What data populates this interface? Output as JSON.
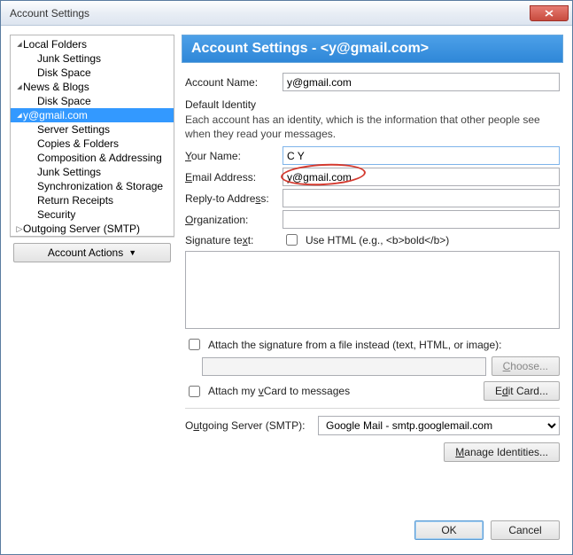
{
  "window": {
    "title": "Account Settings"
  },
  "tree": {
    "items": [
      {
        "label": "Local Folders",
        "level": 0,
        "expanded": true,
        "selected": false
      },
      {
        "label": "Junk Settings",
        "level": 1,
        "selected": false
      },
      {
        "label": "Disk Space",
        "level": 1,
        "selected": false
      },
      {
        "label": "News & Blogs",
        "level": 0,
        "expanded": true,
        "selected": false
      },
      {
        "label": "Disk Space",
        "level": 1,
        "selected": false
      },
      {
        "label": "y@gmail.com",
        "level": 0,
        "expanded": true,
        "selected": true
      },
      {
        "label": "Server Settings",
        "level": 1,
        "selected": false
      },
      {
        "label": "Copies & Folders",
        "level": 1,
        "selected": false
      },
      {
        "label": "Composition & Addressing",
        "level": 1,
        "selected": false
      },
      {
        "label": "Junk Settings",
        "level": 1,
        "selected": false
      },
      {
        "label": "Synchronization & Storage",
        "level": 1,
        "selected": false
      },
      {
        "label": "Return Receipts",
        "level": 1,
        "selected": false
      },
      {
        "label": "Security",
        "level": 1,
        "selected": false
      },
      {
        "label": "Outgoing Server (SMTP)",
        "level": 0,
        "expanded": false,
        "selected": false
      }
    ],
    "account_actions_label": "Account Actions"
  },
  "panel": {
    "header": "Account Settings - <y@gmail.com>",
    "account_name_label": "Account Name:",
    "account_name_value": "y@gmail.com",
    "identity_heading": "Default Identity",
    "identity_hint": "Each account has an identity, which is the information that other people see when they read your messages.",
    "your_name_label": "Your Name:",
    "your_name_value": "C Y",
    "email_label": "Email Address:",
    "email_value": "y@gmail.com",
    "replyto_label": "Reply-to Address:",
    "replyto_value": "",
    "org_label": "Organization:",
    "org_value": "",
    "sig_label": "Signature text:",
    "use_html_label": "Use HTML (e.g., <b>bold</b>)",
    "attach_file_label": "Attach the signature from a file instead (text, HTML, or image):",
    "choose_label": "Choose...",
    "attach_vcard_label": "Attach my vCard to messages",
    "edit_card_label": "Edit Card...",
    "smtp_label": "Outgoing Server (SMTP):",
    "smtp_value": "Google Mail - smtp.googlemail.com",
    "manage_identities_label": "Manage Identities..."
  },
  "footer": {
    "ok": "OK",
    "cancel": "Cancel"
  }
}
